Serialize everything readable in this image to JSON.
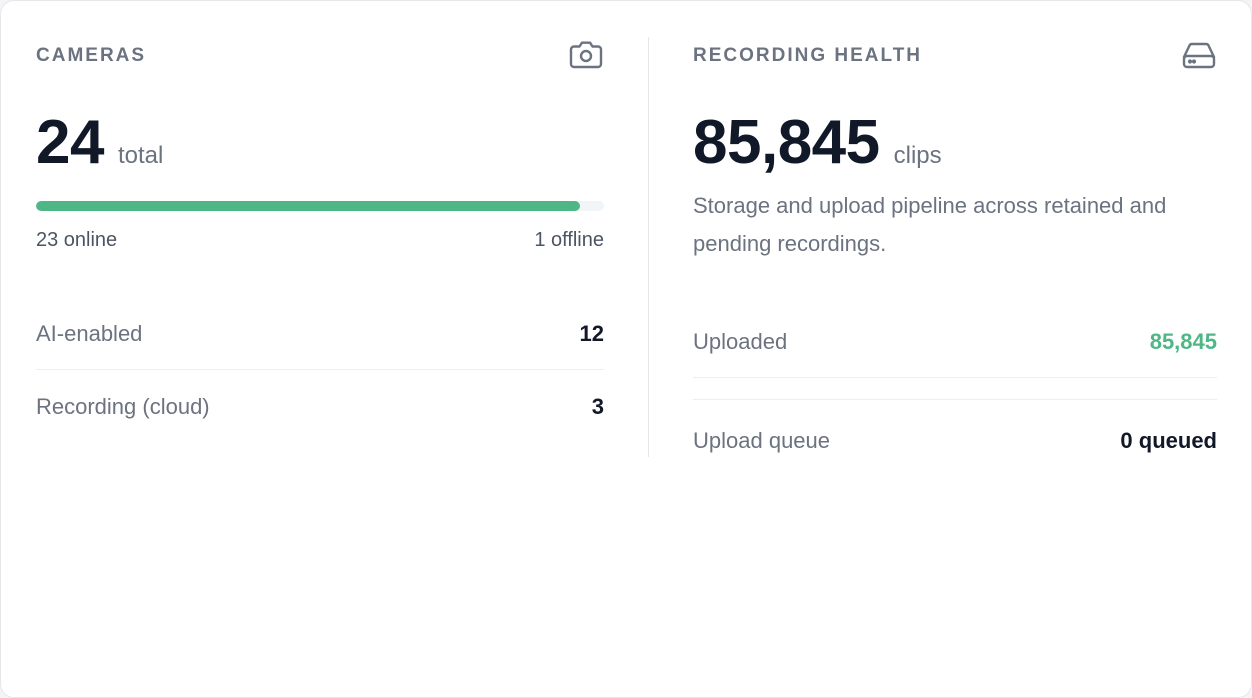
{
  "cameras": {
    "title": "CAMERAS",
    "icon": "camera-icon",
    "total_value": "24",
    "total_unit": "total",
    "online_fraction": 0.9583,
    "online_label": "23 online",
    "offline_label": "1 offline",
    "rows": [
      {
        "label": "AI-enabled",
        "value": "12"
      },
      {
        "label": "Recording (cloud)",
        "value": "3"
      }
    ]
  },
  "recording_health": {
    "title": "RECORDING HEALTH",
    "icon": "hard-drive-icon",
    "clips_value": "85,845",
    "clips_unit": "clips",
    "description": "Storage and upload pipeline across retained and pending recordings.",
    "rows": [
      {
        "label": "Uploaded",
        "value": "85,845"
      },
      {
        "label": "Upload queue",
        "value": "0 queued"
      }
    ]
  },
  "colors": {
    "accent_green": "#4fb786",
    "muted_text": "#6b7280",
    "strong_text": "#111827"
  }
}
